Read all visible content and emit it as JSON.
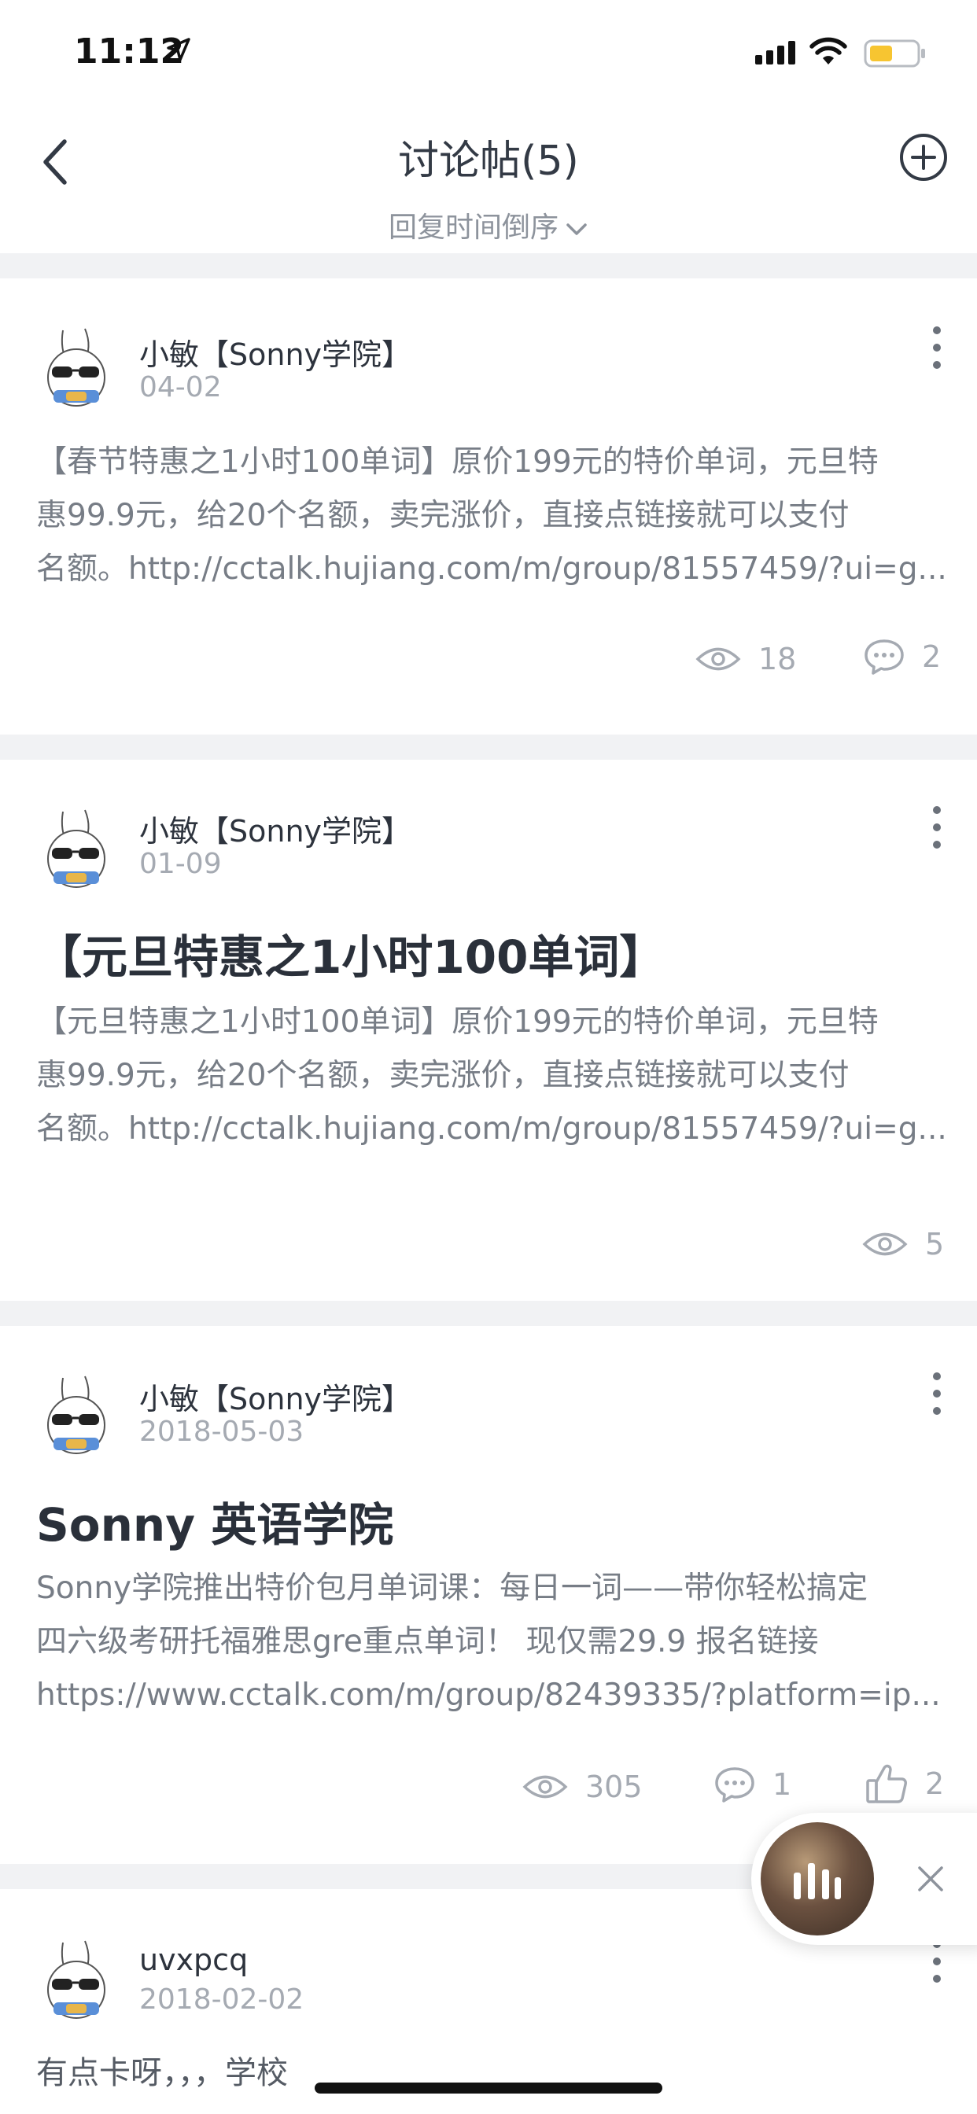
{
  "status_bar": {
    "time": "11:12"
  },
  "header": {
    "title": "讨论帖(5)",
    "sort_label": "回复时间倒序"
  },
  "posts": [
    {
      "author": "小敏【Sonny学院】",
      "date": "04-02",
      "title": "",
      "body_lines": [
        "【春节特惠之1小时100单词】原价199元的特价单词，元旦特",
        "惠99.9元，给20个名额，卖完涨价，直接点链接就可以支付",
        "名额。http://cctalk.hujiang.com/m/group/81557459/?ui=g..."
      ],
      "views": "18",
      "comments": "2",
      "likes": ""
    },
    {
      "author": "小敏【Sonny学院】",
      "date": "01-09",
      "title": "【元旦特惠之1小时100单词】",
      "body_lines": [
        "【元旦特惠之1小时100单词】原价199元的特价单词，元旦特",
        "惠99.9元，给20个名额，卖完涨价，直接点链接就可以支付",
        "名额。http://cctalk.hujiang.com/m/group/81557459/?ui=g..."
      ],
      "views": "5",
      "comments": "",
      "likes": ""
    },
    {
      "author": "小敏【Sonny学院】",
      "date": "2018-05-03",
      "title": "Sonny 英语学院",
      "body_lines": [
        "Sonny学院推出特价包月单词课：每日一词——带你轻松搞定",
        "四六级考研托福雅思gre重点单词！ 现仅需29.9 报名链接",
        "https://www.cctalk.com/m/group/82439335/?platform=ip..."
      ],
      "views": "305",
      "comments": "1",
      "likes": "2"
    },
    {
      "author": "uvxpcq",
      "date": "2018-02-02",
      "title": "",
      "body_lines": [
        "有点卡呀，，，学校"
      ],
      "views": "",
      "comments": "",
      "likes": ""
    }
  ],
  "icons": {
    "back": "chevron-left-icon",
    "add": "plus-circle-icon",
    "sort": "chevron-down-icon",
    "more": "more-vertical-icon",
    "views": "eye-icon",
    "comments": "comment-bubble-icon",
    "likes": "thumbs-up-icon",
    "close": "close-icon"
  },
  "colors": {
    "divider": "#f1f2f4",
    "title_text": "#333a45",
    "body_text": "#777d86",
    "meta_text": "#a5aab2",
    "battery": "#f7c531"
  }
}
